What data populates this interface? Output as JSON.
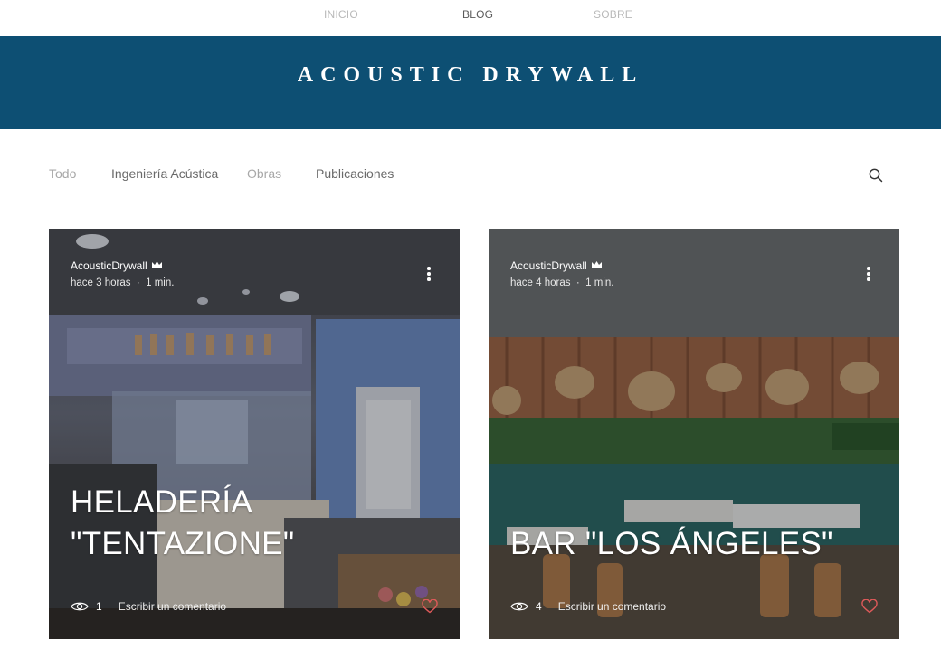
{
  "nav": {
    "items": [
      {
        "label": "INICIO"
      },
      {
        "label": "BLOG"
      },
      {
        "label": "SOBRE"
      }
    ],
    "active": "BLOG"
  },
  "banner": {
    "title": "ACOUSTIC DRYWALL",
    "color": "#0d4f73"
  },
  "categories": [
    "Todo",
    "Ingeniería Acústica",
    "Obras",
    "Publicaciones"
  ],
  "search": {
    "icon": "search-icon"
  },
  "posts": [
    {
      "author": "AcousticDrywall",
      "author_badge": "crown-icon",
      "time": "hace 3 horas",
      "read_time": "1 min.",
      "title_line1": "HELADERÍA",
      "title_line2": "\"TENTAZIONE\"",
      "views": "1",
      "comment_label": "Escribir un comentario",
      "like_icon": "heart-icon"
    },
    {
      "author": "AcousticDrywall",
      "author_badge": "crown-icon",
      "time": "hace 4 horas",
      "read_time": "1 min.",
      "title_line1": "BAR \"LOS ÁNGELES\"",
      "title_line2": "",
      "views": "4",
      "comment_label": "Escribir un comentario",
      "like_icon": "heart-icon"
    }
  ],
  "colors": {
    "accent": "#0d4f73",
    "heart": "#e05a5a"
  }
}
